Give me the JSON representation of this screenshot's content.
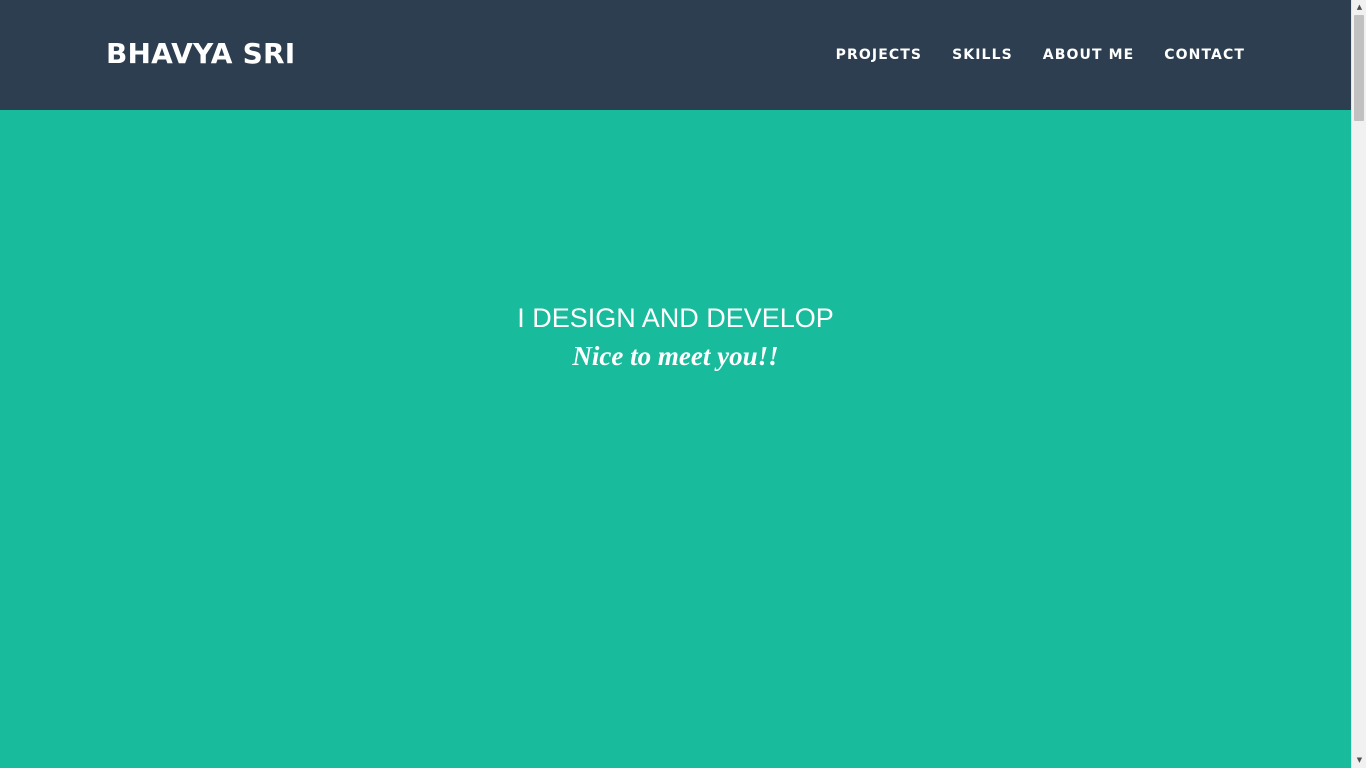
{
  "header": {
    "brand": "BHAVYA SRI",
    "nav": [
      "PROJECTS",
      "SKILLS",
      "ABOUT ME",
      "CONTACT"
    ]
  },
  "hero": {
    "title": "I DESIGN AND DEVELOP",
    "subtitle": "Nice to meet you!!"
  },
  "scrollbar": {
    "up_arrow": "▲",
    "down_arrow": "▼"
  },
  "colors": {
    "navbar": "#2c3e50",
    "hero": "#18bc9c",
    "text": "#ffffff"
  }
}
